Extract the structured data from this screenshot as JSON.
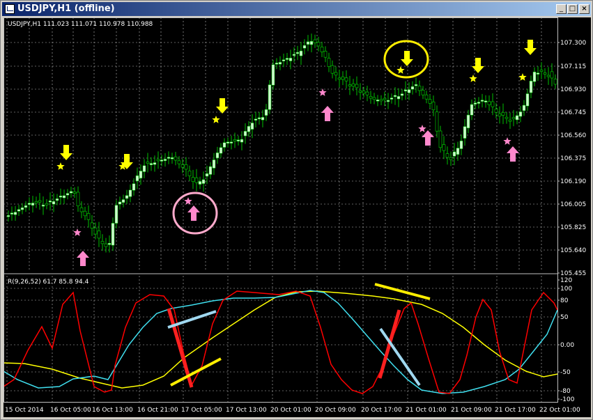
{
  "window": {
    "title": "USDJPY,H1 (offline)",
    "min_label": "_",
    "max_label": "□",
    "close_label": "×"
  },
  "chart": {
    "info_text": "USDJPY,H1  111.023 111.071 110.978 110.988",
    "price_ticks": [
      "107.300",
      "107.115",
      "106.930",
      "106.745",
      "106.560",
      "106.375",
      "106.190",
      "106.005",
      "105.825",
      "105.640",
      "105.455"
    ],
    "osc_label": "R(9,26,52) 61.7 85.8 94.4",
    "osc_ticks": [
      "120",
      "100",
      "80",
      "50",
      "0.00",
      "-50",
      "-80",
      "-100"
    ],
    "time_labels": [
      "15 Oct 2014",
      "16 Oct 05:00",
      "16 Oct 13:00",
      "16 Oct 21:00",
      "17 Oct 05:00",
      "17 Oct 13:00",
      "20 Oct 01:00",
      "20 Oct 09:00",
      "20 Oct 17:00",
      "21 Oct 01:00",
      "21 Oct 09:00",
      "21 Oct 17:00",
      "22 Oct 01:00"
    ],
    "colors": {
      "background": "#000000",
      "grid": "#c0c0c0",
      "bull_candle": "#ccffcc",
      "candle_wick": "#00c000",
      "axis_text": "#ffffff",
      "sell_arrow": "#ffff00",
      "buy_arrow": "#ff88cc",
      "osc_fast": "#ff0000",
      "osc_mid": "#40e0f0",
      "osc_slow": "#ffff00",
      "annot_red": "#ff2020",
      "annot_yellow": "#ffee00",
      "annot_lightblue": "#a0d8f0",
      "highlight_yellow": "#ffee00",
      "highlight_pink": "#ffaacc"
    }
  }
}
